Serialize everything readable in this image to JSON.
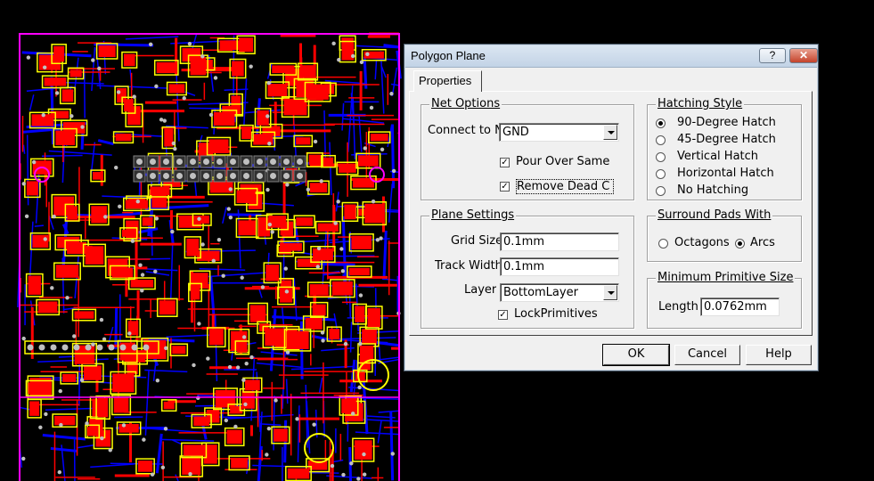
{
  "colors": {
    "background": "#000000",
    "board_outline": "#ff00ff",
    "top_copper": "#ff0000",
    "bottom_copper": "#0000ff",
    "silkscreen": "#ffff00",
    "via": "#c0c0c0"
  },
  "dialog": {
    "title": "Polygon Plane",
    "help_button": "?",
    "close_button": "✕",
    "tab_label": "Properties",
    "net_options": {
      "title": "Net Options",
      "connect_label": "Connect to N",
      "connect_value": "GND",
      "pour_over_same": {
        "label": "Pour Over Same",
        "checked": true
      },
      "remove_dead": {
        "label": "Remove Dead C",
        "checked": true
      }
    },
    "plane_settings": {
      "title": "Plane Settings",
      "grid_size_label": "Grid Size",
      "grid_size_value": "0.1mm",
      "track_width_label": "Track Width",
      "track_width_value": "0.1mm",
      "layer_label": "Layer",
      "layer_value": "BottomLayer",
      "lock_primitives": {
        "label": "LockPrimitives",
        "checked": true
      }
    },
    "hatching_style": {
      "title": "Hatching Style",
      "options": [
        "90-Degree Hatch",
        "45-Degree Hatch",
        "Vertical Hatch",
        "Horizontal Hatch",
        "No Hatching"
      ],
      "selected": "90-Degree Hatch"
    },
    "surround_pads": {
      "title": "Surround Pads With",
      "options": [
        "Octagons",
        "Arcs"
      ],
      "selected": "Arcs"
    },
    "min_primitive": {
      "title": "Minimum Primitive Size",
      "length_label": "Length",
      "length_value": "0.0762mm"
    },
    "buttons": {
      "ok": "OK",
      "cancel": "Cancel",
      "help": "Help"
    }
  }
}
